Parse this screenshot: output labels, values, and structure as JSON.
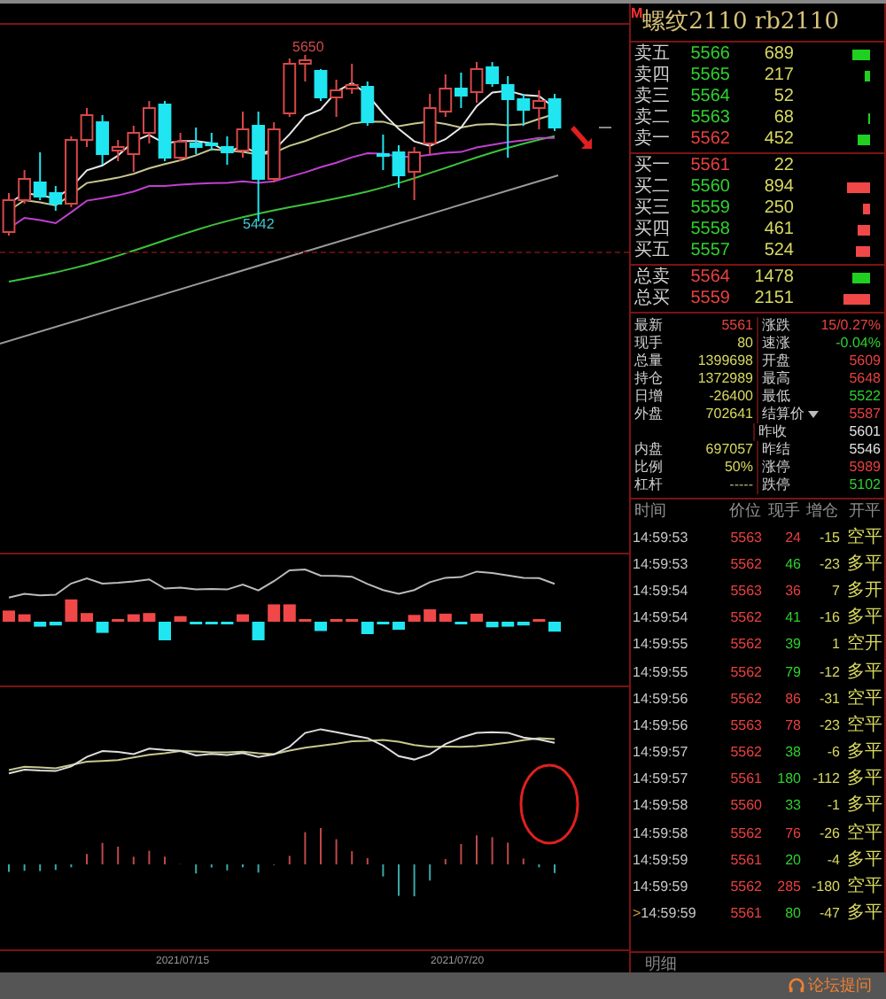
{
  "chart_labels": {
    "high": "5650",
    "low": "5442"
  },
  "dates": [
    "2021/07/15",
    "2021/07/20"
  ],
  "header": {
    "badge": "M",
    "title": "螺纹2110 rb2110"
  },
  "asks": [
    {
      "label": "卖五",
      "price": "5566",
      "color": "#2ed12e",
      "volume": "689"
    },
    {
      "label": "卖四",
      "price": "5565",
      "color": "#2ed12e",
      "volume": "217"
    },
    {
      "label": "卖三",
      "price": "5564",
      "color": "#2ed12e",
      "volume": "52"
    },
    {
      "label": "卖二",
      "price": "5563",
      "color": "#2ed12e",
      "volume": "68"
    },
    {
      "label": "卖一",
      "price": "5562",
      "color": "#e84040",
      "volume": "452"
    }
  ],
  "bids": [
    {
      "label": "买一",
      "price": "5561",
      "color": "#e84040",
      "volume": "22"
    },
    {
      "label": "买二",
      "price": "5560",
      "color": "#2ed12e",
      "volume": "894"
    },
    {
      "label": "买三",
      "price": "5559",
      "color": "#2ed12e",
      "volume": "250"
    },
    {
      "label": "买四",
      "price": "5558",
      "color": "#2ed12e",
      "volume": "461"
    },
    {
      "label": "买五",
      "price": "5557",
      "color": "#2ed12e",
      "volume": "524"
    }
  ],
  "totals": [
    {
      "label": "总卖",
      "price": "5564",
      "volume": "1478",
      "kind": "ask"
    },
    {
      "label": "总买",
      "price": "5559",
      "volume": "2151",
      "kind": "bid"
    }
  ],
  "stats": [
    {
      "left": {
        "label": "最新",
        "value": "5561",
        "color": "#e84040"
      },
      "right": {
        "label": "涨跌",
        "value": "15/0.27%",
        "color": "#e84040"
      }
    },
    {
      "left": {
        "label": "现手",
        "value": "80",
        "color": "#d8d860"
      },
      "right": {
        "label": "速涨",
        "value": "-0.04%",
        "color": "#2ed12e"
      }
    },
    {
      "left": {
        "label": "总量",
        "value": "1399698",
        "color": "#d8d860"
      },
      "right": {
        "label": "开盘",
        "value": "5609",
        "color": "#e84040"
      }
    },
    {
      "left": {
        "label": "持仓",
        "value": "1372989",
        "color": "#d8d860"
      },
      "right": {
        "label": "最高",
        "value": "5648",
        "color": "#e84040"
      }
    },
    {
      "left": {
        "label": "日增",
        "value": "-26400",
        "color": "#d8d860"
      },
      "right": {
        "label": "最低",
        "value": "5522",
        "color": "#2ed12e"
      }
    },
    {
      "left": {
        "label": "外盘",
        "value": "702641",
        "color": "#d8d860"
      },
      "right": {
        "label": "结算价",
        "value": "5587",
        "color": "#e84040",
        "dropdown": true
      }
    },
    {
      "right": {
        "label": "昨收",
        "value": "5601",
        "color": "#e0e0e0"
      }
    },
    {
      "left": {
        "label": "内盘",
        "value": "697057",
        "color": "#d8d860"
      },
      "right": {
        "label": "昨结",
        "value": "5546",
        "color": "#e0e0e0"
      }
    },
    {
      "left": {
        "label": "比例",
        "value": "50%",
        "color": "#d8d860"
      },
      "right": {
        "label": "涨停",
        "value": "5989",
        "color": "#e84040"
      }
    },
    {
      "left": {
        "label": "杠杆",
        "value": "-----"
      },
      "right": {
        "label": "跌停",
        "value": "5102",
        "color": "#2ed12e"
      }
    }
  ],
  "trades": {
    "columns": [
      "时间",
      "价位",
      "现手",
      "增仓",
      "开平"
    ],
    "rows": [
      {
        "time": "14:59:53",
        "price": "5563",
        "volume": "24",
        "kind": "sell",
        "change": "-15",
        "type": "空平"
      },
      {
        "time": "14:59:53",
        "price": "5562",
        "volume": "46",
        "kind": "buy",
        "change": "-23",
        "type": "多平"
      },
      {
        "time": "14:59:54",
        "price": "5563",
        "volume": "36",
        "kind": "sell",
        "change": "7",
        "type": "多开"
      },
      {
        "time": "14:59:54",
        "price": "5562",
        "volume": "41",
        "kind": "buy",
        "change": "-16",
        "type": "多平"
      },
      {
        "time": "14:59:55",
        "price": "5562",
        "volume": "39",
        "kind": "buy",
        "change": "1",
        "type": "空开"
      },
      {
        "time": "14:59:55",
        "price": "5562",
        "volume": "79",
        "kind": "buy",
        "change": "-12",
        "type": "多平"
      },
      {
        "time": "14:59:56",
        "price": "5562",
        "volume": "86",
        "kind": "sell",
        "change": "-31",
        "type": "空平"
      },
      {
        "time": "14:59:56",
        "price": "5563",
        "volume": "78",
        "kind": "sell",
        "change": "-23",
        "type": "空平"
      },
      {
        "time": "14:59:57",
        "price": "5562",
        "volume": "38",
        "kind": "buy",
        "change": "-6",
        "type": "多平"
      },
      {
        "time": "14:59:57",
        "price": "5561",
        "volume": "180",
        "kind": "buy",
        "change": "-112",
        "type": "多平"
      },
      {
        "time": "14:59:58",
        "price": "5560",
        "volume": "33",
        "kind": "buy",
        "change": "-1",
        "type": "多平"
      },
      {
        "time": "14:59:58",
        "price": "5562",
        "volume": "76",
        "kind": "sell",
        "change": "-26",
        "type": "空平"
      },
      {
        "time": "14:59:59",
        "price": "5561",
        "volume": "20",
        "kind": "buy",
        "change": "-4",
        "type": "多平"
      },
      {
        "time": "14:59:59",
        "price": "5562",
        "volume": "285",
        "kind": "sell",
        "change": "-180",
        "type": "空平"
      },
      {
        "time": "14:59:59",
        "price": "5561",
        "volume": "80",
        "kind": "buy",
        "change": "-47",
        "type": "多平",
        "marker": ">"
      }
    ]
  },
  "bottom_tab": "明细",
  "forum_link": "论坛提问"
}
